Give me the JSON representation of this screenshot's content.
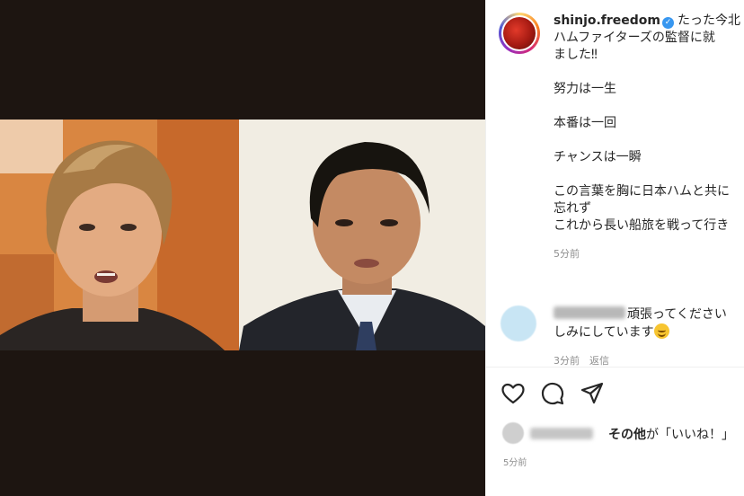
{
  "post": {
    "username": "shinjo.freedom",
    "caption_lines": [
      "たった今北",
      "ハムファイターズの監督に就",
      "ました‼",
      "",
      "努力は一生",
      "",
      "本番は一回",
      "",
      "チャンスは一瞬",
      "",
      "この言葉を胸に日本ハムと共に",
      "忘れず",
      "これから長い船旅を戦って行き"
    ],
    "caption_time": "5分前"
  },
  "comment": {
    "text_line1": "頑張ってください",
    "text_line2": "しみにしています",
    "meta": "3分前　返信"
  },
  "likes": {
    "others": "その他",
    "suffix": "が「いいね！」"
  },
  "post_time": "5分前",
  "icons": {
    "like": "heart-icon",
    "comment": "comment-icon",
    "share": "send-icon",
    "verified": "verified-badge-icon"
  },
  "colors": {
    "media_background": "#1d1511",
    "verified": "#3897f0",
    "muted_text": "#8e8e8e"
  }
}
